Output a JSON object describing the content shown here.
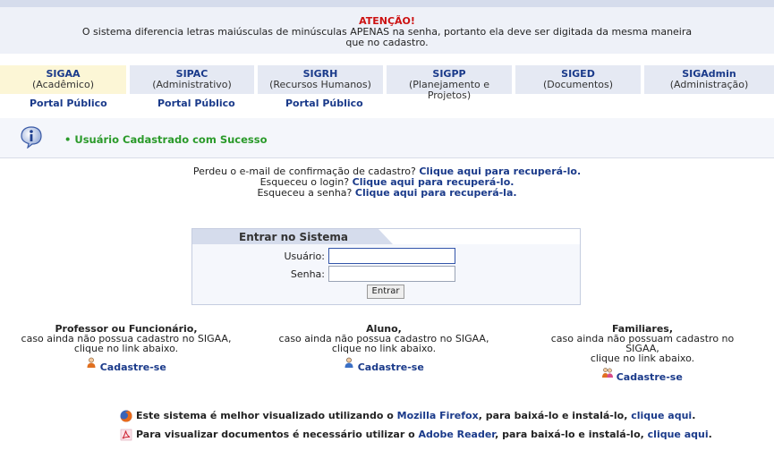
{
  "alert": {
    "title": "ATENÇÃO!",
    "line1": "O sistema diferencia letras maiúsculas de minúsculas APENAS na senha, portanto ela deve ser digitada da mesma maneira",
    "line2": "que no cadastro."
  },
  "systems": [
    {
      "name": "SIGAA",
      "desc": "(Acadêmico)"
    },
    {
      "name": "SIPAC",
      "desc": "(Administrativo)"
    },
    {
      "name": "SIGRH",
      "desc": "(Recursos Humanos)"
    },
    {
      "name": "SIGPP",
      "desc": "(Planejamento e Projetos)"
    },
    {
      "name": "SIGED",
      "desc": "(Documentos)"
    },
    {
      "name": "SIGAdmin",
      "desc": "(Administração)"
    }
  ],
  "portal_label": "Portal Público",
  "message": "Usuário Cadastrado com Sucesso",
  "recover": {
    "email_text": "Perdeu o e-mail de confirmação de cadastro?",
    "email_link": "Clique aqui para recuperá-lo.",
    "login_text": "Esqueceu o login?",
    "login_link": "Clique aqui para recuperá-lo.",
    "pass_text": "Esqueceu a senha?",
    "pass_link": "Clique aqui para recuperá-la."
  },
  "login": {
    "title": "Entrar no Sistema",
    "user_label": "Usuário:",
    "pass_label": "Senha:",
    "user_value": "",
    "pass_value": "",
    "button": "Entrar"
  },
  "registration": [
    {
      "title": "Professor ou Funcionário,",
      "line1": "caso ainda não possua cadastro no SIGAA,",
      "line2": "clique no link abaixo.",
      "link": "Cadastre-se"
    },
    {
      "title": "Aluno,",
      "line1": "caso ainda não possua cadastro no SIGAA,",
      "line2": "clique no link abaixo.",
      "link": "Cadastre-se"
    },
    {
      "title": "Familiares,",
      "line1": "caso ainda não possuam cadastro no SIGAA,",
      "line2": "clique no link abaixo.",
      "link": "Cadastre-se"
    }
  ],
  "footer": {
    "firefox_text1": "Este sistema é melhor visualizado utilizando o",
    "firefox_link": "Mozilla Firefox",
    "firefox_text2": ", para baixá-lo e instalá-lo,",
    "firefox_link2": "clique aqui",
    "firefox_end": ".",
    "reader_text1": "Para visualizar documentos é necessário utilizar o",
    "reader_link": "Adobe Reader",
    "reader_text2": ", para baixá-lo e instalá-lo,",
    "reader_link2": "clique aqui",
    "reader_end": "."
  },
  "colors": {
    "link": "#1a3a8a",
    "alert": "#cc1111",
    "success": "#2a9a2a"
  }
}
